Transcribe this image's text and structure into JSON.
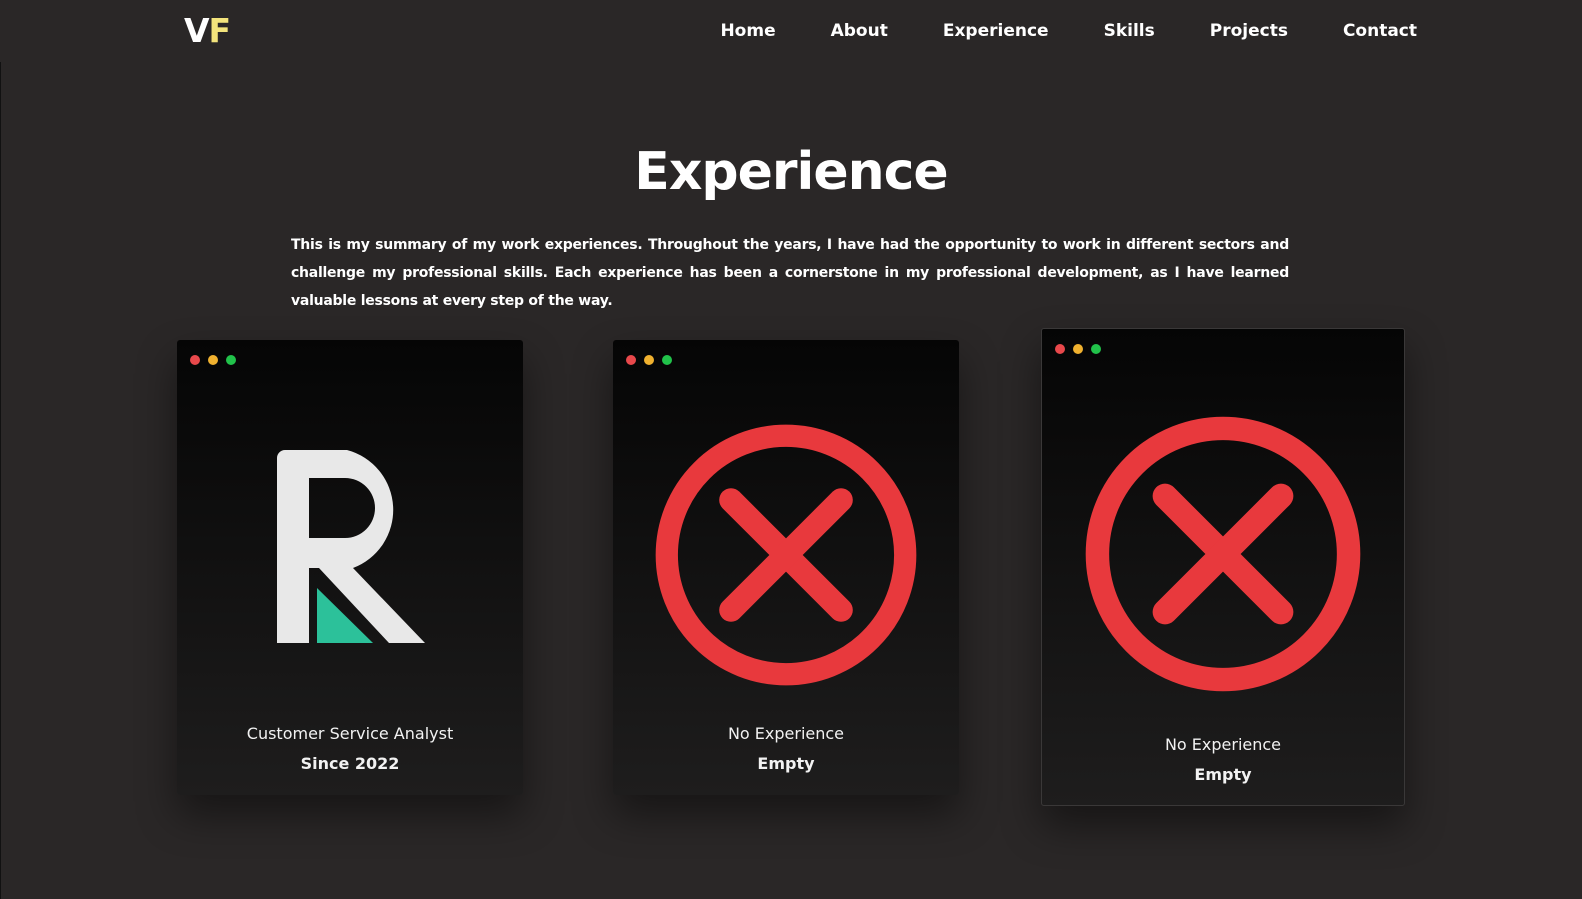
{
  "header": {
    "logo_v": "V",
    "logo_f": "F",
    "nav": [
      "Home",
      "About",
      "Experience",
      "Skills",
      "Projects",
      "Contact"
    ]
  },
  "section": {
    "title": "Experience",
    "summary": "This is my summary of my work experiences. Throughout the years, I have had the opportunity to work in different sectors and challenge my professional skills. Each experience has been a cornerstone in my professional development, as I have learned valuable lessons at every step of the way."
  },
  "cards": [
    {
      "title": "Customer Service Analyst",
      "subtitle": "Since 2022",
      "icon": "r-company-logo"
    },
    {
      "title": "No Experience",
      "subtitle": "Empty",
      "icon": "x-circle-icon"
    },
    {
      "title": "No Experience",
      "subtitle": "Empty",
      "icon": "x-circle-icon"
    }
  ],
  "colors": {
    "background": "#2a2727",
    "logo_accent": "#f3e47c",
    "x_icon_red": "#e8393d",
    "logo_teal": "#2cc19a",
    "window_dot_red": "#e8484b",
    "window_dot_yellow": "#f0b12f",
    "window_dot_green": "#21c24a"
  }
}
